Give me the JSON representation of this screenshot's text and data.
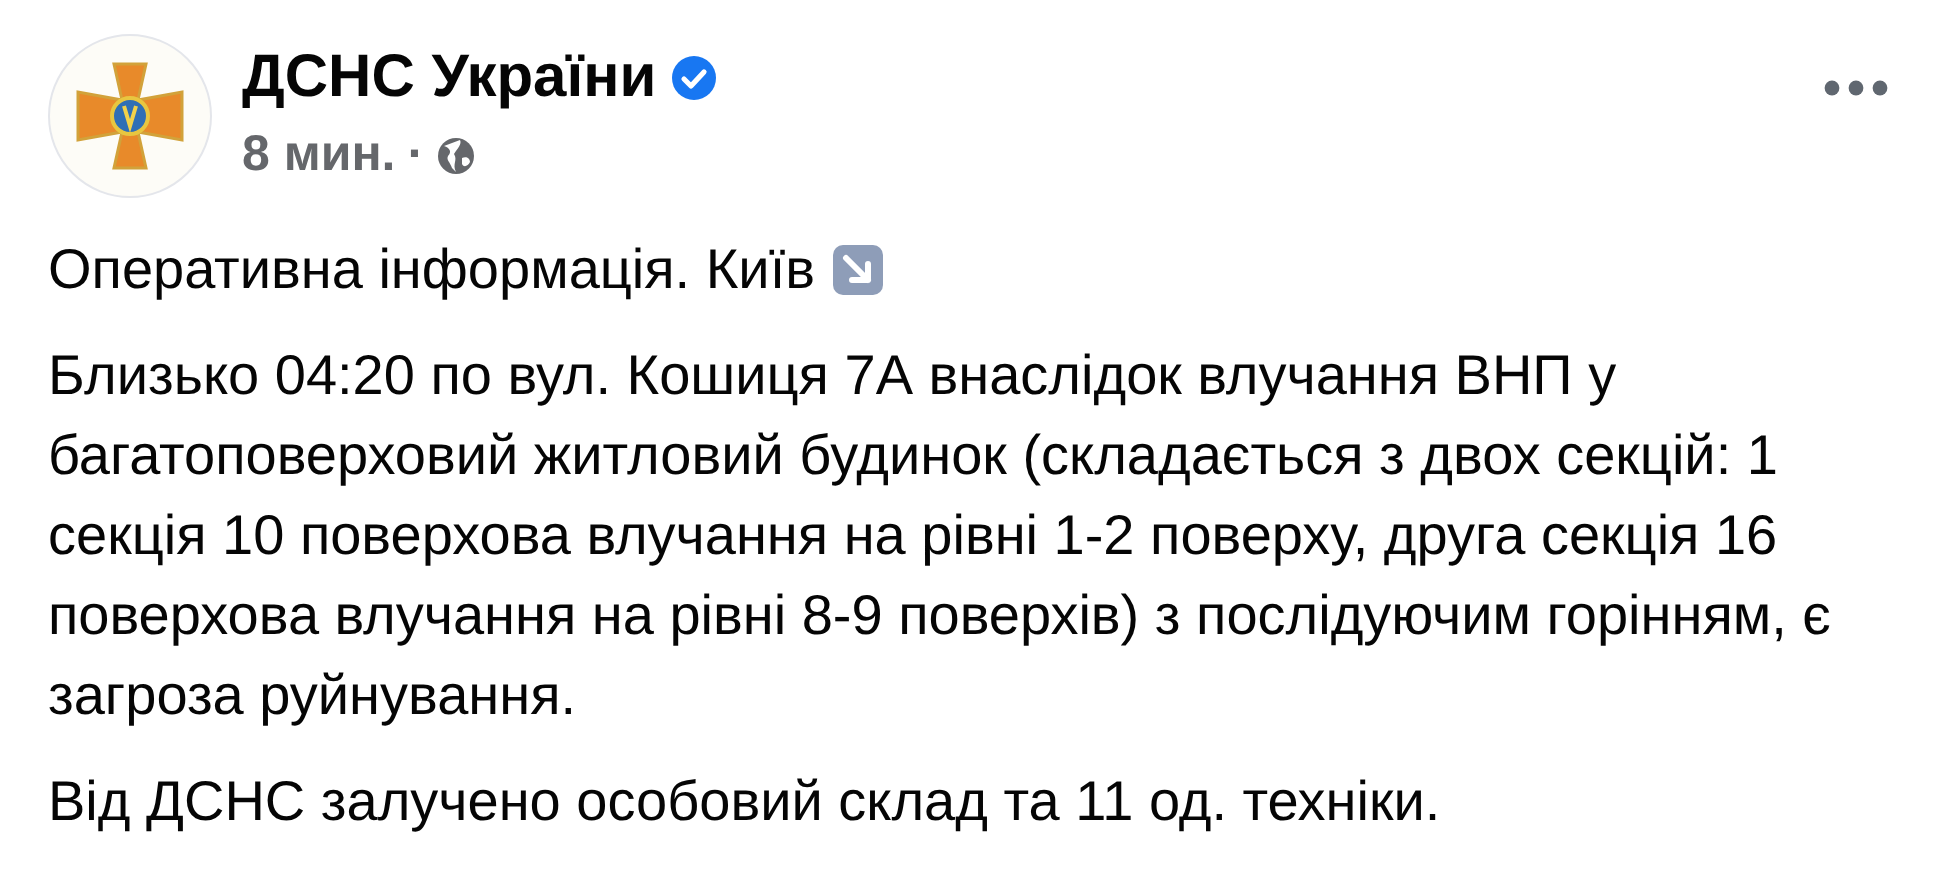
{
  "post": {
    "author": "ДСНС України",
    "verified": true,
    "time": "8 мин.",
    "separator": "·",
    "paragraphs": [
      "Оперативна інформація. Київ",
      "Близько 04:20 по вул. Кошиця 7А внаслідок влучання ВНП у багатоповерховий житловий будинок (складається з двох секцій: 1 секція 10 поверхова влучання на рівні 1-2 поверху, друга секція 16 поверхова влучання на рівні 8-9 поверхів) з послідуючим горінням, є загроза руйнування.",
      "Від ДСНС залучено особовий склад та 11 од. техніки."
    ]
  }
}
